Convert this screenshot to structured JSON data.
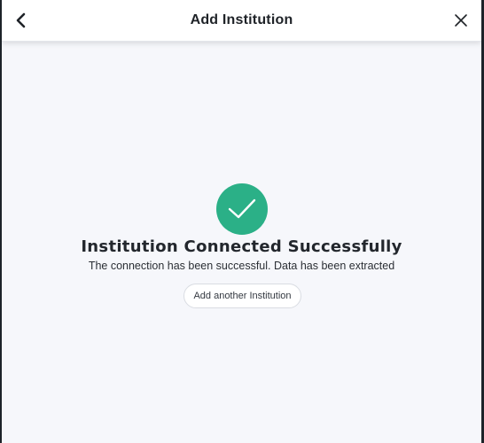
{
  "header": {
    "title": "Add Institution",
    "back_icon": "chevron-left-icon",
    "close_icon": "close-icon"
  },
  "status": {
    "icon": "checkmark-icon",
    "icon_color": "#2bb087",
    "title": "Institution Connected Successfully",
    "message": "The connection has been successful. Data has been extracted"
  },
  "actions": {
    "add_another_label": "Add another Institution"
  }
}
